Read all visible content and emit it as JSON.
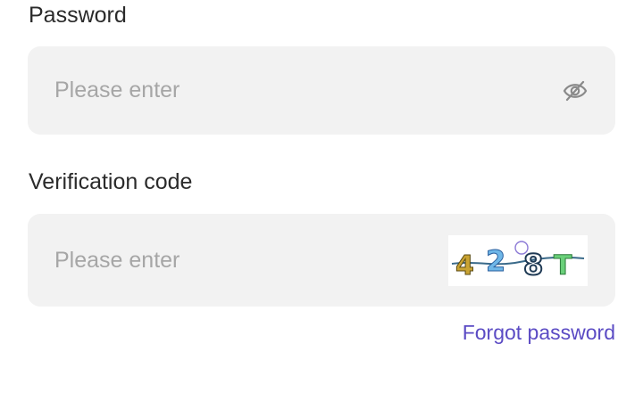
{
  "password": {
    "label": "Password",
    "placeholder": "Please enter",
    "toggle_icon": "eye-off-icon"
  },
  "verification": {
    "label": "Verification code",
    "placeholder": "Please enter",
    "captcha_text": "428T"
  },
  "links": {
    "forgot_password": "Forgot password"
  },
  "colors": {
    "link": "#5b4bc4",
    "input_bg": "#f2f2f2",
    "label": "#2b2b2b",
    "placeholder": "#a6a6a6"
  }
}
